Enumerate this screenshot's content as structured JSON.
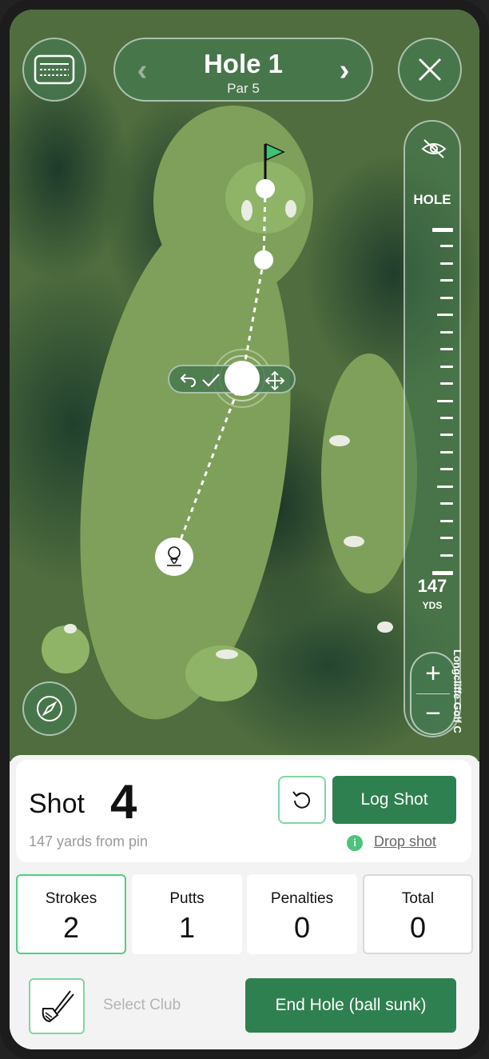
{
  "header": {
    "hole_title": "Hole 1",
    "par_label": "Par 5",
    "prev_icon": "chevron-left-icon",
    "next_icon": "chevron-right-icon",
    "scorecard_icon": "scorecard-icon",
    "close_icon": "close-icon"
  },
  "rangefinder": {
    "visibility_icon": "eye-off-icon",
    "hole_label": "HOLE",
    "distance_value": "147",
    "distance_unit": "YDS",
    "zoom_in": "+",
    "zoom_out": "−"
  },
  "map": {
    "compass_icon": "compass-icon",
    "shot_controls": [
      "undo-icon",
      "check-icon",
      "move-icon"
    ],
    "tee_icon": "golf-tee-icon",
    "flag_icon": "flag-icon",
    "credit": "Longcliffe Golf C"
  },
  "shot_panel": {
    "shot_word": "Shot",
    "shot_number": "4",
    "yards_from_pin": "147 yards from pin",
    "reset_icon": "reset-icon",
    "log_shot_label": "Log Shot",
    "drop_shot_label": "Drop shot",
    "info_icon_text": "i"
  },
  "stats": [
    {
      "label": "Strokes",
      "value": "2"
    },
    {
      "label": "Putts",
      "value": "1"
    },
    {
      "label": "Penalties",
      "value": "0"
    },
    {
      "label": "Total",
      "value": "0"
    }
  ],
  "footer": {
    "club_icon": "golf-club-icon",
    "select_club_label": "Select Club",
    "end_hole_label": "End Hole (ball sunk)"
  },
  "colors": {
    "accent": "#2f8050",
    "accent_light": "#4fcf86",
    "flag": "#3fc276"
  }
}
